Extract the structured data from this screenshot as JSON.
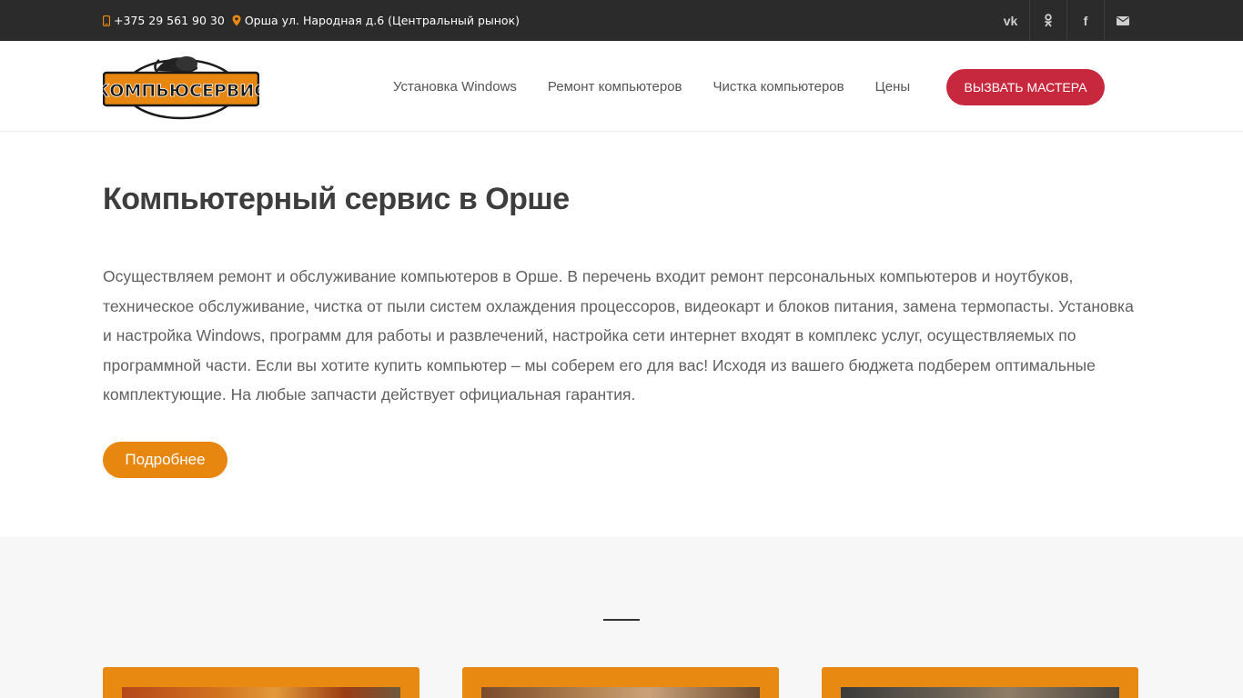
{
  "topbar": {
    "phone": "+375 29 561 90 30",
    "address": "Орша ул. Народная д.6 (Центральный рынок)",
    "socials": [
      {
        "name": "vk-icon",
        "glyph": "vk"
      },
      {
        "name": "odnoklassniki-icon",
        "glyph": "ok"
      },
      {
        "name": "facebook-icon",
        "glyph": "f"
      },
      {
        "name": "mail-icon",
        "glyph": "✉"
      }
    ]
  },
  "header": {
    "logo_text": "КОМПЬЮСЕРВИС",
    "nav": [
      "Установка Windows",
      "Ремонт компьютеров",
      "Чистка компьютеров",
      "Цены"
    ],
    "cta_label": "ВЫЗВАТЬ МАСТЕРА"
  },
  "intro": {
    "title": "Компьютерный сервис в Орше",
    "text": "Осуществляем ремонт и обслуживание компьютеров в Орше. В перечень входит ремонт персональных компьютеров и ноутбуков, техническое обслуживание, чистка от пыли систем охлаждения процессоров, видеокарт и блоков питания, замена термопасты. Установка и настройка Windows, программ для работы и развлечений, настройка сети интернет входят в комплекс услуг, осуществляемых по программной части. Если вы хотите купить компьютер – мы соберем его для вас! Исходя из вашего бюджета подберем оптимальные комплектующие. На любые запчасти действует официальная гарантия.",
    "more_label": "Подробнее"
  },
  "colors": {
    "accent_orange": "#e88a12",
    "cta_red": "#c8283d",
    "topbar_bg": "#2b2b2b"
  }
}
